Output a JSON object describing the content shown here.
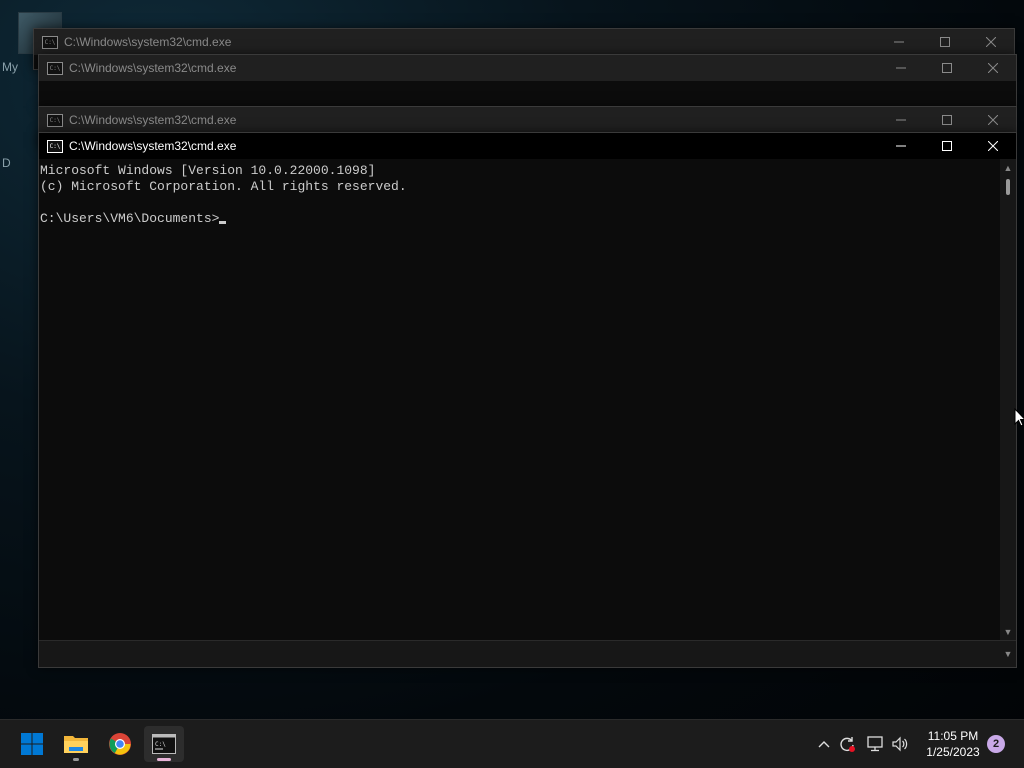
{
  "desktop": {
    "label_fragments": [
      "My",
      "D"
    ]
  },
  "windows": [
    {
      "title": "C:\\Windows\\system32\\cmd.exe",
      "state": "inactive"
    },
    {
      "title": "C:\\Windows\\system32\\cmd.exe",
      "state": "inactive"
    },
    {
      "title": "C:\\Windows\\system32\\cmd.exe",
      "state": "inactive"
    },
    {
      "title": "C:\\Windows\\system32\\cmd.exe",
      "state": "active",
      "console_lines": [
        "Microsoft Windows [Version 10.0.22000.1098]",
        "(c) Microsoft Corporation. All rights reserved.",
        "",
        "C:\\Users\\VM6\\Documents>"
      ]
    }
  ],
  "title_icon_text": "C:\\",
  "taskbar": {
    "apps": [
      {
        "name": "start",
        "icon": "windows-logo-icon"
      },
      {
        "name": "file-explorer",
        "icon": "folder-icon"
      },
      {
        "name": "chrome",
        "icon": "chrome-icon"
      },
      {
        "name": "command-prompt",
        "icon": "cmd-icon",
        "active": true
      }
    ],
    "tray_icons": [
      "chevron-up-icon",
      "sync-icon",
      "network-icon",
      "volume-icon"
    ],
    "time": "11:05 PM",
    "date": "1/25/2023",
    "notification_count": "2"
  },
  "colors": {
    "accent": "#0078d4",
    "active_indicator": "#e8b4d8",
    "console_text": "#cccccc",
    "console_bg": "#0c0c0c"
  }
}
